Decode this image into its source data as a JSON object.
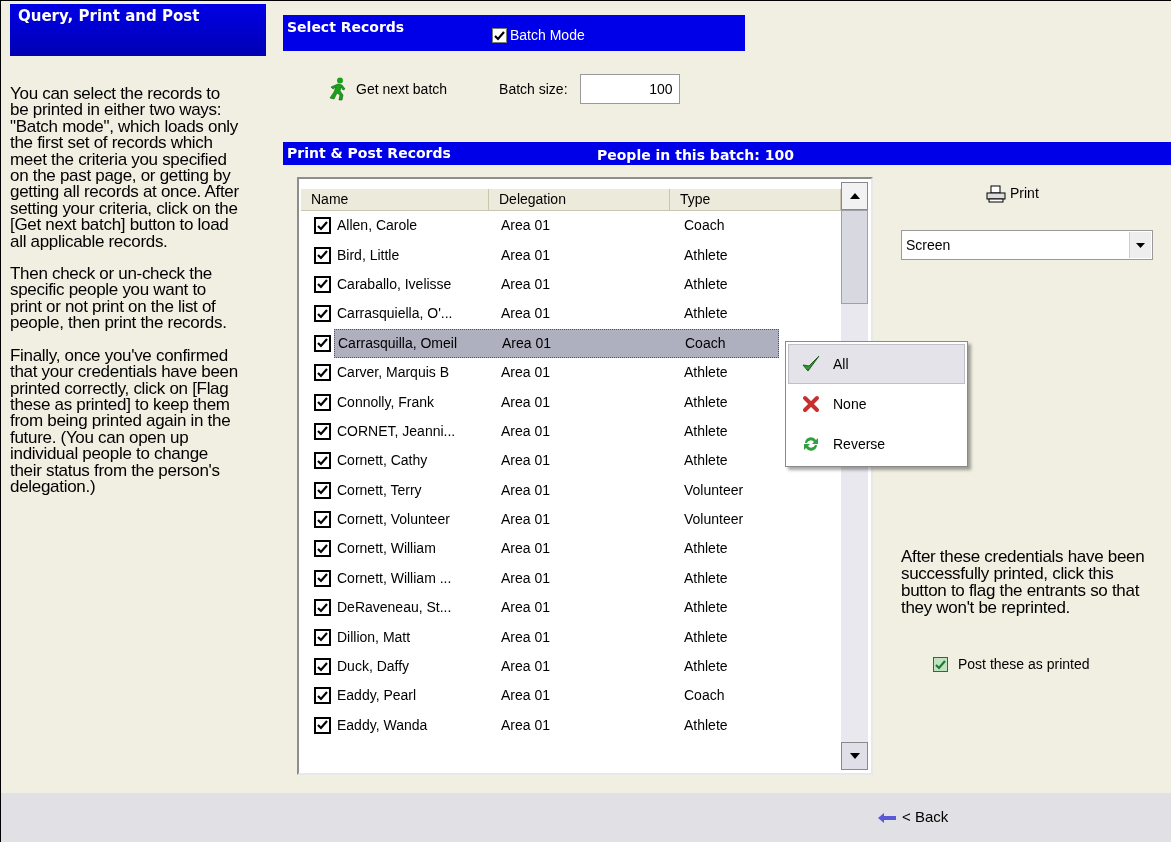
{
  "sidebar": {
    "title": "Query, Print and Post",
    "paragraphs": [
      "You can select the records to be printed in either two ways: \"Batch mode\", which loads only the first set of records which meet the criteria you specified on the past page, or getting by getting all records at once. After setting your criteria, click on the [Get next batch] button to load all applicable records.",
      "Then check or un-check the specific people you want to print or not print on the list of people, then print the records.",
      "Finally, once you've confirmed that your credentials have been printed correctly, click on [Flag these as printed] to keep them from being printed again in the future. (You can open up individual people to change their status from the person's delegation.)"
    ]
  },
  "select_records": {
    "title": "Select Records",
    "batch_mode": {
      "label": "Batch Mode",
      "checked": true
    },
    "get_next_batch": "Get next batch",
    "batch_size_label": "Batch size:",
    "batch_size": "100"
  },
  "print_post": {
    "title": "Print & Post Records",
    "count": "People in this batch: 100"
  },
  "table": {
    "columns": [
      "Name",
      "Delegation",
      "Type"
    ],
    "rows": [
      {
        "name": "Allen, Carole",
        "delegation": "Area 01",
        "type": "Coach",
        "checked": true,
        "selected": false
      },
      {
        "name": "Bird, Little",
        "delegation": "Area 01",
        "type": "Athlete",
        "checked": true,
        "selected": false
      },
      {
        "name": "Caraballo, Ivelisse",
        "delegation": "Area 01",
        "type": "Athlete",
        "checked": true,
        "selected": false
      },
      {
        "name": "Carrasquiella, O'...",
        "delegation": "Area 01",
        "type": "Athlete",
        "checked": true,
        "selected": false
      },
      {
        "name": "Carrasquilla, Omeil",
        "delegation": "Area 01",
        "type": "Coach",
        "checked": true,
        "selected": true
      },
      {
        "name": "Carver, Marquis B",
        "delegation": "Area 01",
        "type": "Athlete",
        "checked": true,
        "selected": false
      },
      {
        "name": "Connolly, Frank",
        "delegation": "Area 01",
        "type": "Athlete",
        "checked": true,
        "selected": false
      },
      {
        "name": "CORNET, Jeanni...",
        "delegation": "Area 01",
        "type": "Athlete",
        "checked": true,
        "selected": false
      },
      {
        "name": "Cornett, Cathy",
        "delegation": "Area 01",
        "type": "Athlete",
        "checked": true,
        "selected": false
      },
      {
        "name": "Cornett, Terry",
        "delegation": "Area 01",
        "type": "Volunteer",
        "checked": true,
        "selected": false
      },
      {
        "name": "Cornett, Volunteer",
        "delegation": "Area 01",
        "type": "Volunteer",
        "checked": true,
        "selected": false
      },
      {
        "name": "Cornett, William",
        "delegation": "Area 01",
        "type": "Athlete",
        "checked": true,
        "selected": false
      },
      {
        "name": "Cornett, William ...",
        "delegation": "Area 01",
        "type": "Athlete",
        "checked": true,
        "selected": false
      },
      {
        "name": "DeRaveneau, St...",
        "delegation": "Area 01",
        "type": "Athlete",
        "checked": true,
        "selected": false
      },
      {
        "name": "Dillion, Matt",
        "delegation": "Area 01",
        "type": "Athlete",
        "checked": true,
        "selected": false
      },
      {
        "name": "Duck, Daffy",
        "delegation": "Area 01",
        "type": "Athlete",
        "checked": true,
        "selected": false
      },
      {
        "name": "Eaddy, Pearl",
        "delegation": "Area 01",
        "type": "Coach",
        "checked": true,
        "selected": false
      },
      {
        "name": "Eaddy, Wanda",
        "delegation": "Area 01",
        "type": "Athlete",
        "checked": true,
        "selected": false
      }
    ]
  },
  "context_menu": [
    {
      "label": "All",
      "kind": "check",
      "selected": true
    },
    {
      "label": "None",
      "kind": "cross",
      "selected": false
    },
    {
      "label": "Reverse",
      "kind": "refresh",
      "selected": false
    }
  ],
  "print": {
    "button": "Print",
    "destination": "Screen"
  },
  "post": {
    "note": "After these credentials have been successfully printed, click this button to flag the entrants so that they won't be reprinted.",
    "checkbox": {
      "label": "Post these as printed",
      "checked": true
    }
  },
  "footer": {
    "back": "< Back"
  }
}
